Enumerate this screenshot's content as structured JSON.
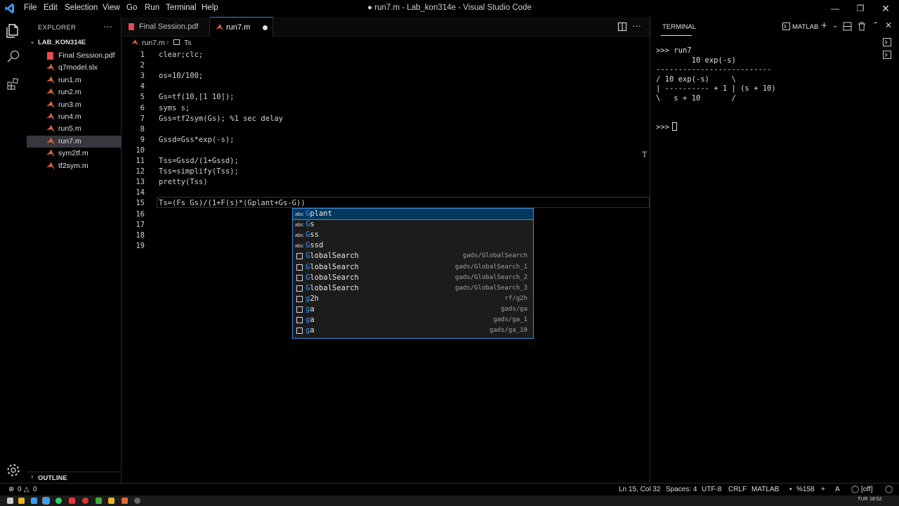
{
  "window": {
    "title": "● run7.m - Lab_kon314e - Visual Studio Code",
    "menu": [
      "File",
      "Edit",
      "Selection",
      "View",
      "Go",
      "Run",
      "Terminal",
      "Help"
    ]
  },
  "sidebar": {
    "title": "EXPLORER",
    "folder": "LAB_KON314E",
    "files": [
      {
        "name": "Final Session.pdf",
        "type": "pdf"
      },
      {
        "name": "q7model.slx",
        "type": "matlab"
      },
      {
        "name": "run1.m",
        "type": "matlab"
      },
      {
        "name": "run2.m",
        "type": "matlab"
      },
      {
        "name": "run3.m",
        "type": "matlab"
      },
      {
        "name": "run4.m",
        "type": "matlab"
      },
      {
        "name": "run5.m",
        "type": "matlab"
      },
      {
        "name": "run7.m",
        "type": "matlab",
        "active": true
      },
      {
        "name": "sym2tf.m",
        "type": "matlab"
      },
      {
        "name": "tf2sym.m",
        "type": "matlab"
      }
    ],
    "outline": "OUTLINE"
  },
  "tabs": [
    {
      "label": "Final Session.pdf",
      "active": false
    },
    {
      "label": "run7.m",
      "active": true,
      "dirty": true
    }
  ],
  "breadcrumb": {
    "file": "run7.m",
    "symbol": "Ts"
  },
  "editor": {
    "lines": [
      {
        "n": "1",
        "text": "clear;clc;"
      },
      {
        "n": "2",
        "text": ""
      },
      {
        "n": "3",
        "text": "os=10/100;"
      },
      {
        "n": "4",
        "text": ""
      },
      {
        "n": "5",
        "text": "Gs=tf(10,[1 10]);"
      },
      {
        "n": "6",
        "text": "syms s;"
      },
      {
        "n": "7",
        "text": "Gss=tf2sym(Gs); %1 sec delay"
      },
      {
        "n": "8",
        "text": ""
      },
      {
        "n": "9",
        "text": "Gssd=Gss*exp(-s);"
      },
      {
        "n": "10",
        "text": ""
      },
      {
        "n": "11",
        "text": "Tss=Gssd/(1+Gssd);"
      },
      {
        "n": "12",
        "text": "Tss=simplify(Tss);"
      },
      {
        "n": "13",
        "text": "pretty(Tss)"
      },
      {
        "n": "14",
        "text": ""
      },
      {
        "n": "15",
        "text": "Ts=(Fs Gs)/(1+F(s)*(Gplant+Gs-G))"
      },
      {
        "n": "16",
        "text": ""
      },
      {
        "n": "17",
        "text": ""
      },
      {
        "n": "18",
        "text": ""
      },
      {
        "n": "19",
        "text": ""
      }
    ]
  },
  "suggest": [
    {
      "kind": "abc",
      "match": "G",
      "rest": "plant",
      "detail": ""
    },
    {
      "kind": "abc",
      "match": "G",
      "rest": "s",
      "detail": ""
    },
    {
      "kind": "abc",
      "match": "G",
      "rest": "ss",
      "detail": ""
    },
    {
      "kind": "abc",
      "match": "G",
      "rest": "ssd",
      "detail": ""
    },
    {
      "kind": "box",
      "match": "G",
      "rest": "lobalSearch",
      "detail": "gads/GlobalSearch"
    },
    {
      "kind": "box",
      "match": "G",
      "rest": "lobalSearch",
      "detail": "gads/GlobalSearch_1"
    },
    {
      "kind": "box",
      "match": "G",
      "rest": "lobalSearch",
      "detail": "gads/GlobalSearch_2"
    },
    {
      "kind": "box",
      "match": "G",
      "rest": "lobalSearch",
      "detail": "gads/GlobalSearch_3"
    },
    {
      "kind": "box",
      "match": "g",
      "rest": "2h",
      "detail": "rf/g2h"
    },
    {
      "kind": "box",
      "match": "g",
      "rest": "a",
      "detail": "gads/ga"
    },
    {
      "kind": "box",
      "match": "g",
      "rest": "a",
      "detail": "gads/ga_1"
    },
    {
      "kind": "box",
      "match": "g",
      "rest": "a",
      "detail": "gads/ga_10"
    }
  ],
  "terminal": {
    "tab": "TERMINAL",
    "profile": "MATLAB",
    "output": ">>> run7\n        10 exp(-s)\n--------------------------\n/ 10 exp(-s)     \\\n| ---------- + 1 | (s + 10)\n\\   s + 10       /\n\n\n>>> "
  },
  "statusbar": {
    "problems_errors": "0",
    "problems_warnings": "0",
    "position": "Ln 15, Col 32",
    "spaces": "Spaces: 4",
    "encoding": "UTF-8",
    "eol": "CRLF",
    "language": "MATLAB",
    "zoom": "%158",
    "spell": "[off]"
  },
  "taskbar": {
    "lang": "TUR",
    "time": "18:52"
  },
  "colors": {
    "accent": "#3c8ad6",
    "matlab_icon": "#e2673a",
    "pdf_icon": "#e84b4b"
  }
}
